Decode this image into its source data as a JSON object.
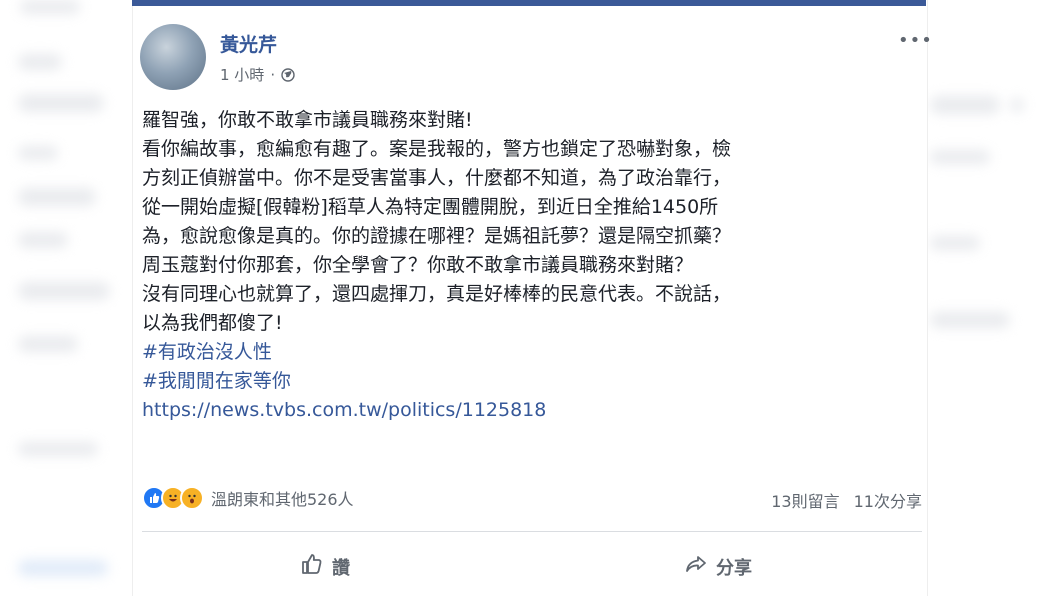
{
  "post": {
    "author": "黃光芹",
    "time": "1 小時",
    "separator": "·",
    "more_label": "•••",
    "lines": [
      "羅智強，你敢不敢拿市議員職務來對賭!",
      "看你編故事，愈編愈有趣了。案是我報的，警方也鎖定了恐嚇對象，檢",
      "方刻正偵辦當中。你不是受害當事人，什麼都不知道，為了政治靠行，",
      "從一開始虛擬[假韓粉]稻草人為特定團體開脫，到近日全推給1450所",
      "為，愈說愈像是真的。你的證據在哪裡？是媽祖託夢？還是隔空抓藥？",
      "周玉蔻對付你那套，你全學會了？你敢不敢拿市議員職務來對賭？",
      "沒有同理心也就算了，還四處揮刀，真是好棒棒的民意代表。不說話，",
      "以為我們都傻了!"
    ],
    "hashtags": [
      "#有政治沒人性",
      "#我閒閒在家等你"
    ],
    "link": "https://news.tvbs.com.tw/politics/1125818"
  },
  "engagement": {
    "reaction_names": "溫朗東和其他526人",
    "comments": "13則留言",
    "shares": "11次分享"
  },
  "actions": {
    "like_label": "讚",
    "share_label": "分享"
  },
  "colors": {
    "link": "#365899",
    "text": "#1d2129",
    "muted": "#606770",
    "brand": "#3b5998"
  }
}
